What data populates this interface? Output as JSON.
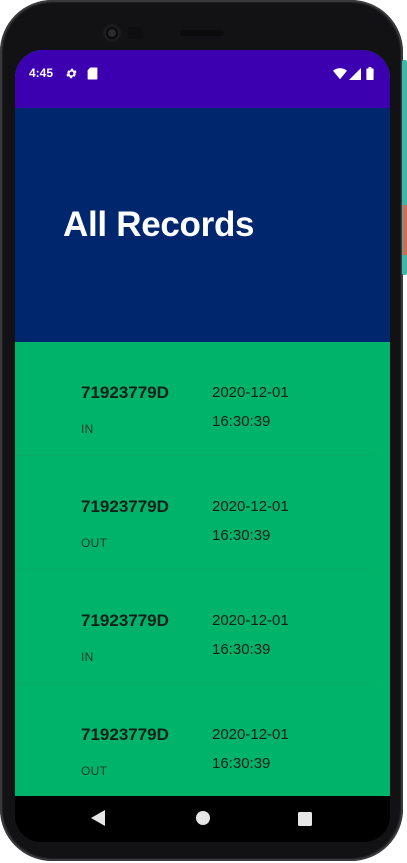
{
  "status_bar": {
    "time": "4:45",
    "icons": [
      "gear-icon",
      "sd-card-icon",
      "wifi-icon",
      "cell-signal-icon",
      "battery-icon"
    ]
  },
  "header": {
    "title": "All Records"
  },
  "records": [
    {
      "id": "71923779D",
      "status": "IN",
      "date": "2020-12-01",
      "time": "16:30:39"
    },
    {
      "id": "71923779D",
      "status": "OUT",
      "date": "2020-12-01",
      "time": "16:30:39"
    },
    {
      "id": "71923779D",
      "status": "IN",
      "date": "2020-12-01",
      "time": "16:30:39"
    },
    {
      "id": "71923779D",
      "status": "OUT",
      "date": "2020-12-01",
      "time": "16:30:39"
    }
  ],
  "nav": {
    "buttons": [
      "back-icon",
      "home-icon",
      "recents-icon"
    ]
  },
  "colors": {
    "status_bar": "#3c00b0",
    "header": "#00266e",
    "list_background": "#00b36b"
  }
}
